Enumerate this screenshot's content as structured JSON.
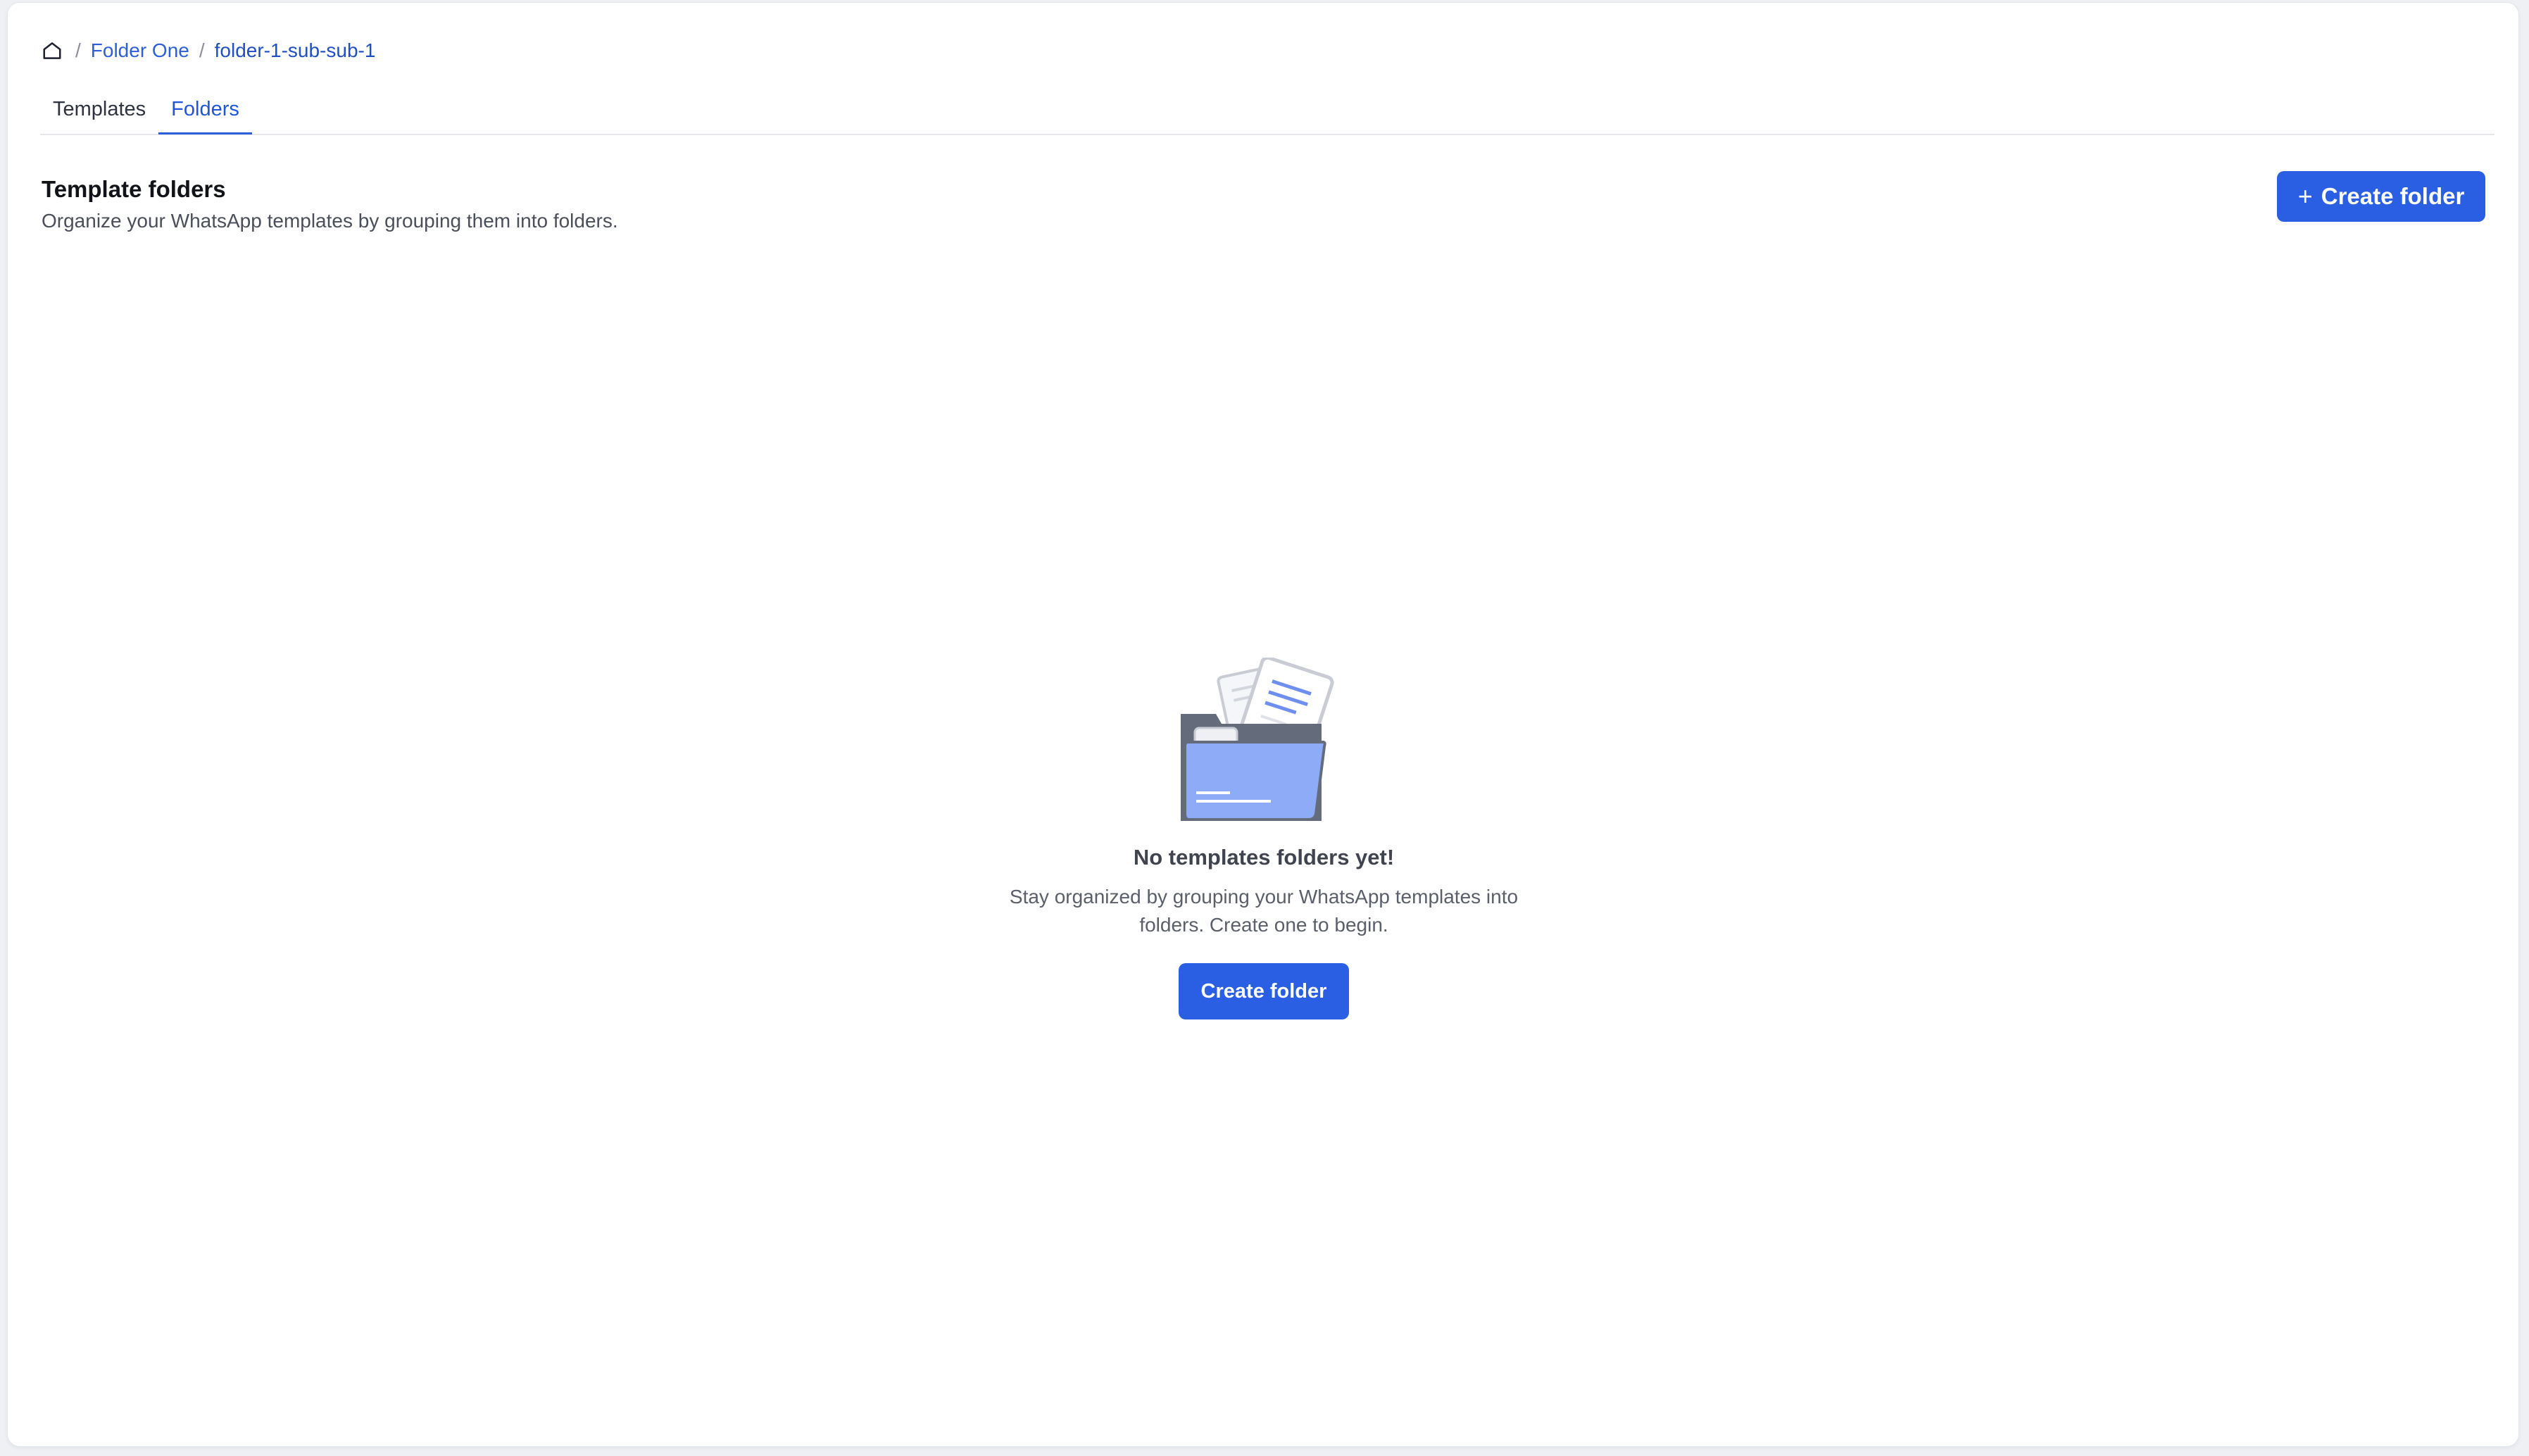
{
  "breadcrumb": {
    "home_icon": "home-icon",
    "separator": "/",
    "items": [
      {
        "label": "Folder One"
      },
      {
        "label": "folder-1-sub-sub-1"
      }
    ]
  },
  "tabs": [
    {
      "label": "Templates",
      "active": false
    },
    {
      "label": "Folders",
      "active": true
    }
  ],
  "section": {
    "title": "Template folders",
    "subtitle": "Organize your WhatsApp templates by grouping them into folders.",
    "create_button": {
      "icon": "plus-icon",
      "label": "Create folder"
    }
  },
  "empty_state": {
    "illustration": "empty-folder-illustration",
    "title": "No templates folders yet!",
    "description": "Stay organized by grouping your WhatsApp templates into folders. Create one to begin.",
    "button_label": "Create folder"
  },
  "colors": {
    "primary": "#2a5ee3",
    "link": "#2c5fd9",
    "background": "#eef0f4"
  }
}
